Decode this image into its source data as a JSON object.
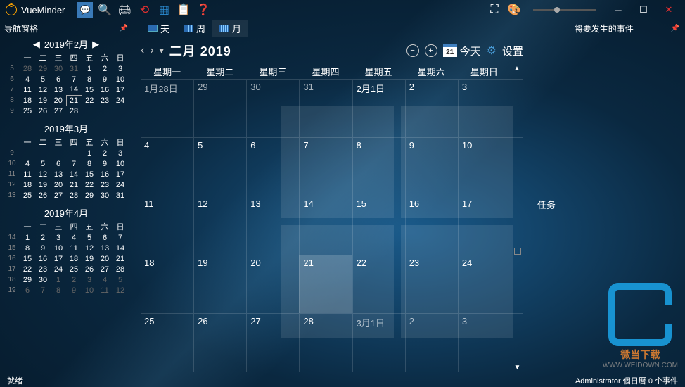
{
  "title": "VueMinder",
  "nav_header": "导航窗格",
  "upcoming_header": "将要发生的事件",
  "tasks_header": "任务",
  "tabs": {
    "day": "天",
    "week": "周",
    "month": "月"
  },
  "month_label": "二月 2019",
  "today_label": "今天",
  "today_num": "21",
  "settings_label": "设置",
  "dow": [
    "星期一",
    "星期二",
    "星期三",
    "星期四",
    "星期五",
    "星期六",
    "星期日"
  ],
  "mini_dow": [
    "一",
    "二",
    "三",
    "四",
    "五",
    "六",
    "日"
  ],
  "mini": [
    {
      "title": "2019年2月",
      "weeks": [
        {
          "w": "5",
          "d": [
            "28",
            "29",
            "30",
            "31",
            "1",
            "2",
            "3"
          ],
          "dim": [
            0,
            1,
            2,
            3
          ]
        },
        {
          "w": "6",
          "d": [
            "4",
            "5",
            "6",
            "7",
            "8",
            "9",
            "10"
          ]
        },
        {
          "w": "7",
          "d": [
            "11",
            "12",
            "13",
            "14",
            "15",
            "16",
            "17"
          ]
        },
        {
          "w": "8",
          "d": [
            "18",
            "19",
            "20",
            "21",
            "22",
            "23",
            "24"
          ],
          "today": 3
        },
        {
          "w": "9",
          "d": [
            "25",
            "26",
            "27",
            "28",
            "",
            "",
            ""
          ]
        }
      ]
    },
    {
      "title": "2019年3月",
      "weeks": [
        {
          "w": "9",
          "d": [
            "",
            "",
            "",
            "",
            "1",
            "2",
            "3"
          ]
        },
        {
          "w": "10",
          "d": [
            "4",
            "5",
            "6",
            "7",
            "8",
            "9",
            "10"
          ]
        },
        {
          "w": "11",
          "d": [
            "11",
            "12",
            "13",
            "14",
            "15",
            "16",
            "17"
          ]
        },
        {
          "w": "12",
          "d": [
            "18",
            "19",
            "20",
            "21",
            "22",
            "23",
            "24"
          ]
        },
        {
          "w": "13",
          "d": [
            "25",
            "26",
            "27",
            "28",
            "29",
            "30",
            "31"
          ]
        }
      ]
    },
    {
      "title": "2019年4月",
      "weeks": [
        {
          "w": "14",
          "d": [
            "1",
            "2",
            "3",
            "4",
            "5",
            "6",
            "7"
          ]
        },
        {
          "w": "15",
          "d": [
            "8",
            "9",
            "10",
            "11",
            "12",
            "13",
            "14"
          ]
        },
        {
          "w": "16",
          "d": [
            "15",
            "16",
            "17",
            "18",
            "19",
            "20",
            "21"
          ]
        },
        {
          "w": "17",
          "d": [
            "22",
            "23",
            "24",
            "25",
            "26",
            "27",
            "28"
          ]
        },
        {
          "w": "18",
          "d": [
            "29",
            "30",
            "1",
            "2",
            "3",
            "4",
            "5"
          ],
          "dim": [
            2,
            3,
            4,
            5,
            6
          ]
        },
        {
          "w": "19",
          "d": [
            "6",
            "7",
            "8",
            "9",
            "10",
            "11",
            "12"
          ],
          "dim": [
            0,
            1,
            2,
            3,
            4,
            5,
            6
          ]
        }
      ]
    }
  ],
  "grid": [
    [
      {
        "t": "1月28日",
        "o": 1
      },
      {
        "t": "29",
        "o": 1
      },
      {
        "t": "30",
        "o": 1
      },
      {
        "t": "31",
        "o": 1
      },
      {
        "t": "2月1日"
      },
      {
        "t": "2"
      },
      {
        "t": "3"
      }
    ],
    [
      {
        "t": "4"
      },
      {
        "t": "5"
      },
      {
        "t": "6"
      },
      {
        "t": "7"
      },
      {
        "t": "8"
      },
      {
        "t": "9"
      },
      {
        "t": "10"
      }
    ],
    [
      {
        "t": "11"
      },
      {
        "t": "12"
      },
      {
        "t": "13"
      },
      {
        "t": "14"
      },
      {
        "t": "15"
      },
      {
        "t": "16"
      },
      {
        "t": "17"
      }
    ],
    [
      {
        "t": "18"
      },
      {
        "t": "19"
      },
      {
        "t": "20"
      },
      {
        "t": "21",
        "today": 1
      },
      {
        "t": "22"
      },
      {
        "t": "23"
      },
      {
        "t": "24"
      }
    ],
    [
      {
        "t": "25"
      },
      {
        "t": "26"
      },
      {
        "t": "27"
      },
      {
        "t": "28"
      },
      {
        "t": "3月1日",
        "o": 1
      },
      {
        "t": "2",
        "o": 1
      },
      {
        "t": "3",
        "o": 1
      }
    ]
  ],
  "status": {
    "left": "就绪",
    "right": "Administrator 個日曆 0 个事件"
  },
  "brand": {
    "text": "微当下载",
    "url": "WWW.WEIDOWN.COM"
  }
}
